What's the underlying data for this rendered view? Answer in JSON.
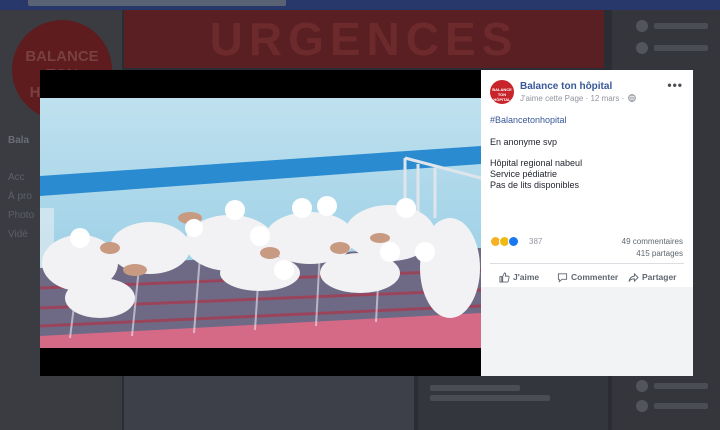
{
  "background": {
    "cover_text": "URGENCES",
    "logo_lines": [
      "BALANCE",
      "TON",
      "HÔPITAL"
    ],
    "nav_items": [
      "Bala",
      "Acc",
      "À pro",
      "Photo",
      "Vidé"
    ]
  },
  "photo": {
    "description_icon": "hospital-photo"
  },
  "post": {
    "avatar_text": "BALANCE TON HÔPITAL",
    "page_name": "Balance ton hôpital",
    "like_page": "J'aime cette Page",
    "separator": " · ",
    "date": "12 mars",
    "separator2": " · ",
    "more": "•••",
    "hashtag": "#Balancetonhopital",
    "lines": [
      "En anonyme svp",
      "Hôpital regional nabeul",
      "Service pédiatrie",
      "Pas de lits disponibles"
    ],
    "reaction_count": "387",
    "comments": "49 commentaires",
    "shares": "415 partages",
    "actions": {
      "like": "J'aime",
      "comment": "Commenter",
      "share": "Partager"
    }
  },
  "colors": {
    "brand": "#c8242b",
    "link": "#385898"
  }
}
